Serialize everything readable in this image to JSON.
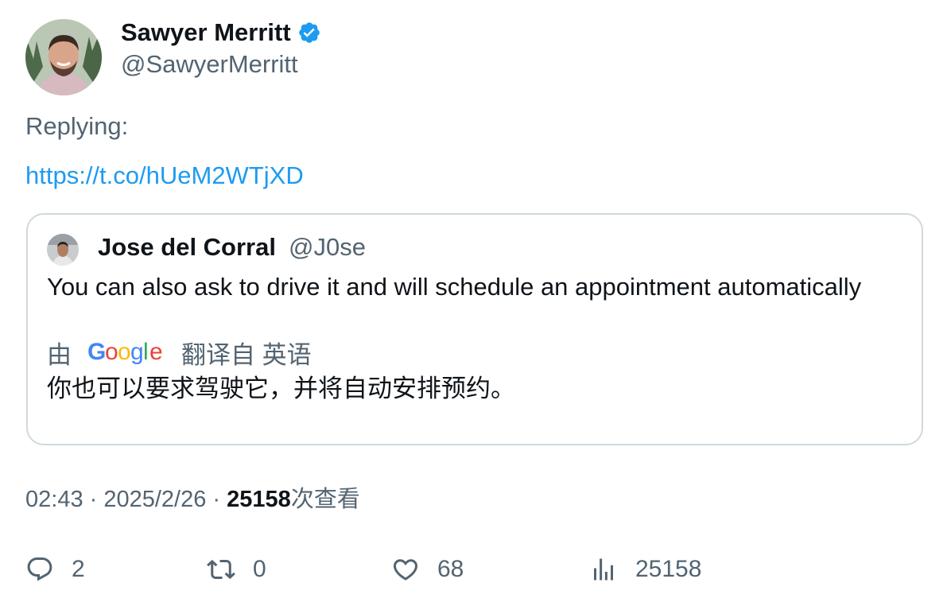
{
  "author": {
    "name": "Sawyer Merritt",
    "handle": "@SawyerMerritt",
    "verified_icon": "verified-badge-icon",
    "verified_color": "#1d9bf0"
  },
  "replying_label": "Replying:",
  "link_text": "https://t.co/hUeM2WTjXD",
  "quote": {
    "name": "Jose del Corral",
    "handle": "@J0se",
    "text": "You can also ask to drive it and will schedule an appointment automatically",
    "translate_prefix": "由",
    "translate_brand": "Google",
    "translate_suffix": "翻译自 英语",
    "translated_text": "你也可以要求驾驶它，并将自动安排预约。"
  },
  "meta": {
    "time": "02:43",
    "separator1": " · ",
    "date": "2025/2/26",
    "separator2": " · ",
    "views_count": "25158",
    "views_label": "次查看"
  },
  "actions": {
    "replies": "2",
    "retweets": "0",
    "likes": "68",
    "views": "25158"
  },
  "colors": {
    "link": "#1d9bf0",
    "secondary_text": "#536471",
    "primary_text": "#0f1419",
    "border": "#cfd9de"
  }
}
